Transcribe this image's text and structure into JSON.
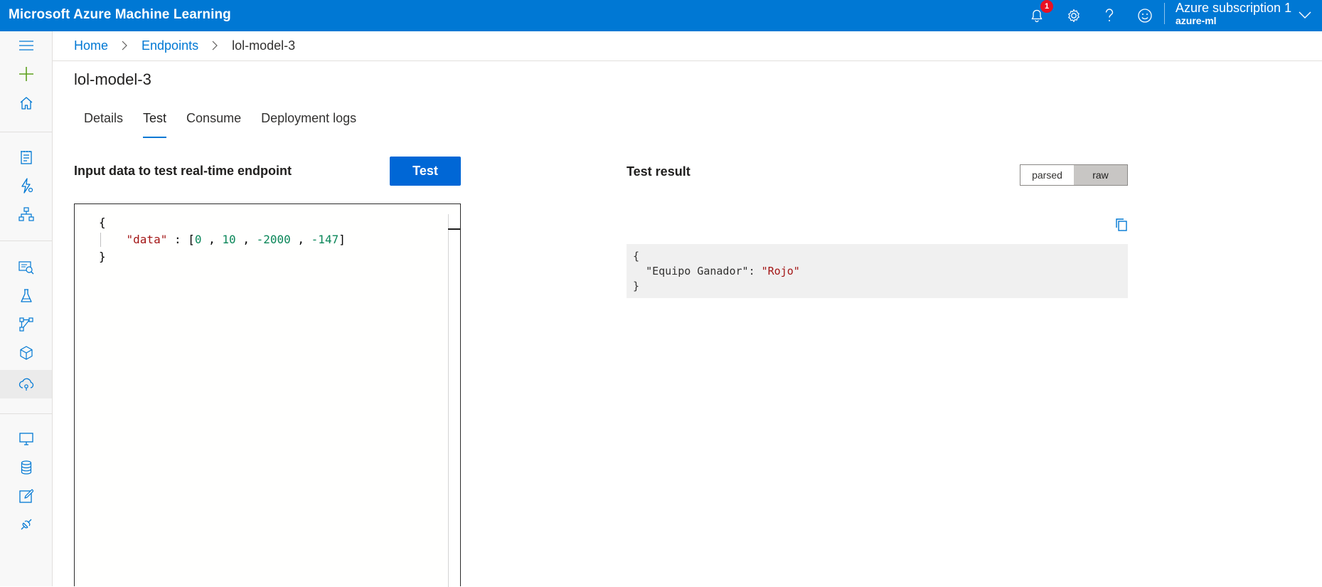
{
  "app": {
    "title": "Microsoft Azure Machine Learning"
  },
  "topbar": {
    "notification_count": "1",
    "icons": [
      "bell-icon",
      "gear-icon",
      "help-icon",
      "smiley-icon"
    ],
    "account": {
      "name": "Azure subscription 1",
      "workspace": "azure-ml"
    }
  },
  "leftnav": {
    "items": [
      "menu-icon",
      "plus-icon",
      "home-icon",
      "notebook-icon",
      "automl-icon",
      "designer-icon",
      "datasets-icon",
      "experiments-icon",
      "pipelines-icon",
      "models-icon",
      "endpoints-icon",
      "compute-icon",
      "datastores-icon",
      "labeling-icon",
      "linked-services-icon"
    ],
    "active": "endpoints-icon"
  },
  "breadcrumb": {
    "home": "Home",
    "endpoints": "Endpoints",
    "current": "lol-model-3"
  },
  "page": {
    "title": "lol-model-3"
  },
  "tabs": [
    {
      "label": "Details",
      "active": false
    },
    {
      "label": "Test",
      "active": true
    },
    {
      "label": "Consume",
      "active": false
    },
    {
      "label": "Deployment logs",
      "active": false
    }
  ],
  "input": {
    "label": "Input data to test real-time endpoint",
    "button": "Test",
    "code": {
      "open_brace": "{",
      "key": "\"data\"",
      "colon": " : ",
      "open_bracket": "[",
      "values": [
        "0",
        "10",
        "-2000",
        "-147"
      ],
      "separator": " , ",
      "close_bracket": "]",
      "close_brace": "}"
    }
  },
  "result": {
    "label": "Test result",
    "toggle": {
      "parsed": "parsed",
      "raw": "raw",
      "selected": "raw"
    },
    "code": {
      "open_brace": "{",
      "key": "\"Equipo Ganador\"",
      "colon": ": ",
      "value": "\"Rojo\"",
      "close_brace": "}"
    }
  },
  "colors": {
    "accent": "#0078d4",
    "button": "#0067d6",
    "badge": "#e81123"
  }
}
